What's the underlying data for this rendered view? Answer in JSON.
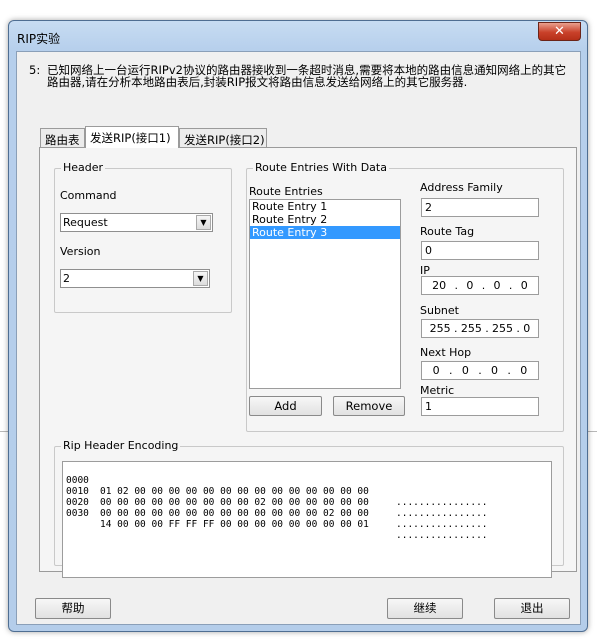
{
  "window": {
    "title": "RIP实验",
    "close_icon": "✕"
  },
  "description": {
    "number": "5:",
    "text": "已知网络上一台运行RIPv2协议的路由器接收到一条超时消息,需要将本地的路由信息通知网络上的其它路由器,请在分析本地路由表后,封装RIP报文将路由信息发送给网络上的其它服务器."
  },
  "tabs": [
    {
      "label": "路由表"
    },
    {
      "label": "发送RIP(接口1)"
    },
    {
      "label": "发送RIP(接口2)"
    }
  ],
  "header_group": {
    "title": "Header",
    "command_label": "Command",
    "command_value": "Request",
    "version_label": "Version",
    "version_value": "2"
  },
  "route_group": {
    "title": "Route Entries With Data",
    "entries_label": "Route Entries",
    "entries": [
      "Route  Entry  1",
      "Route  Entry  2",
      "Route  Entry  3"
    ],
    "selected_index": 2,
    "add_label": "Add",
    "remove_label": "Remove",
    "address_family_label": "Address Family",
    "address_family_value": "2",
    "route_tag_label": "Route Tag",
    "route_tag_value": "0",
    "ip_label": "IP",
    "ip": [
      "20",
      ".",
      "0",
      ".",
      "0",
      ".",
      "0"
    ],
    "subnet_label": "Subnet",
    "subnet": [
      "255",
      ".",
      "255",
      ".",
      "255",
      ".",
      "0"
    ],
    "next_hop_label": "Next Hop",
    "next_hop": [
      "0",
      ".",
      "0",
      ".",
      "0",
      ".",
      "0"
    ],
    "metric_label": "Metric",
    "metric_value": "1"
  },
  "encoding_group": {
    "title": "Rip Header Encoding",
    "rows": [
      {
        "offset": "0000",
        "bytes": "01 02 00 00 00 00 00 00 00 00 00 00 00 00 00 00",
        "ascii": "................"
      },
      {
        "offset": "0010",
        "bytes": "00 00 00 00 00 00 00 00 00 02 00 00 00 00 00 00",
        "ascii": "................"
      },
      {
        "offset": "0020",
        "bytes": "00 00 00 00 00 00 00 00 00 00 00 00 00 02 00 00",
        "ascii": "................"
      },
      {
        "offset": "0030",
        "bytes": "14 00 00 00 FF FF FF 00 00 00 00 00 00 00 00 01",
        "ascii": "................"
      }
    ]
  },
  "footer": {
    "help_label": "帮助",
    "continue_label": "继续",
    "exit_label": "退出"
  },
  "colors": {
    "selection": "#3399ff",
    "title_bar": "#b6cfec",
    "close_button": "#c9412a"
  }
}
